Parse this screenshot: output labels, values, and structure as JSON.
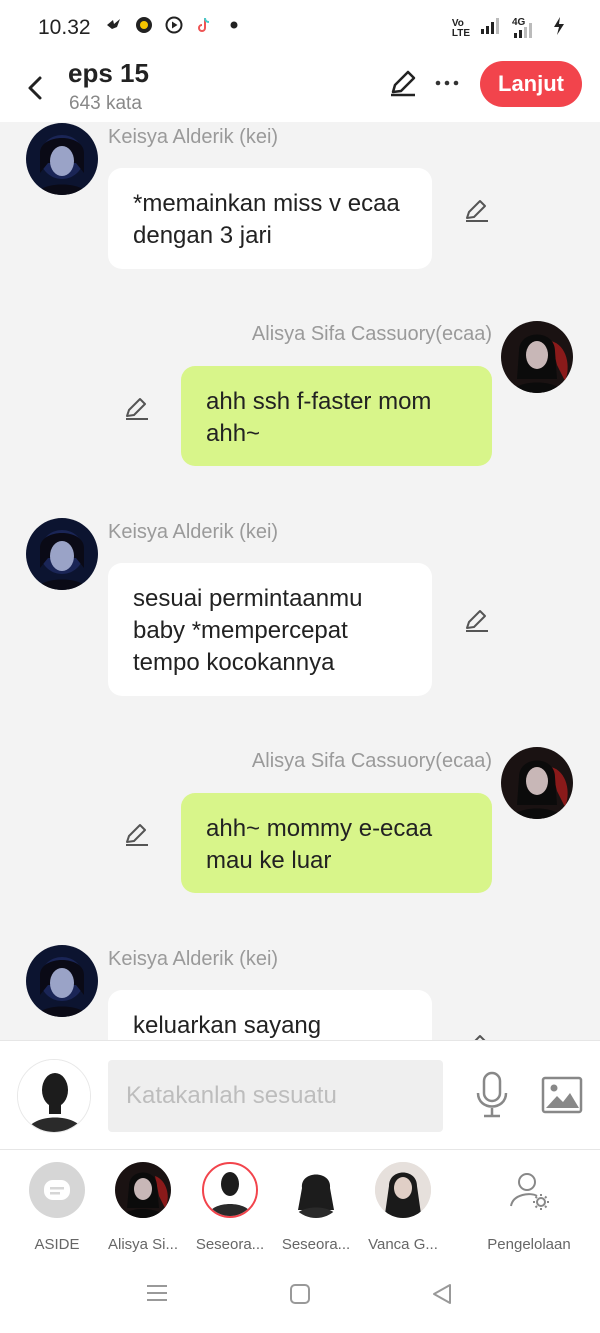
{
  "status_bar": {
    "time": "10.32",
    "net": "4G"
  },
  "header": {
    "title": "eps 15",
    "word_count": "643 kata",
    "next_button": "Lanjut"
  },
  "messages": [
    {
      "side": "left",
      "name": "Keisya Alderik (kei)",
      "text": "*memainkan miss v ecaa dengan 3 jari"
    },
    {
      "side": "right",
      "name": "Alisya Sifa Cassuory(ecaa)",
      "text": "ahh ssh f-faster mom ahh~"
    },
    {
      "side": "left",
      "name": "Keisya Alderik (kei)",
      "text": "sesuai permintaanmu baby *mempercepat tempo kocokannya"
    },
    {
      "side": "right",
      "name": "Alisya Sifa Cassuory(ecaa)",
      "text": "ahh~ mommy e-ecaa mau ke luar"
    },
    {
      "side": "left",
      "name": "Keisya Alderik (kei)",
      "text": "keluarkan sayang"
    }
  ],
  "input": {
    "placeholder": "Katakanlah sesuatu"
  },
  "characters": [
    {
      "label": "ASIDE"
    },
    {
      "label": "Alisya Si..."
    },
    {
      "label": "Seseora..."
    },
    {
      "label": "Seseora..."
    },
    {
      "label": "Vanca G..."
    },
    {
      "label": "Pengelolaan"
    }
  ],
  "colors": {
    "accent": "#f2444c",
    "right_bubble": "#d8f58a",
    "left_bubble": "#ffffff",
    "chat_bg": "#f3f3f3"
  }
}
